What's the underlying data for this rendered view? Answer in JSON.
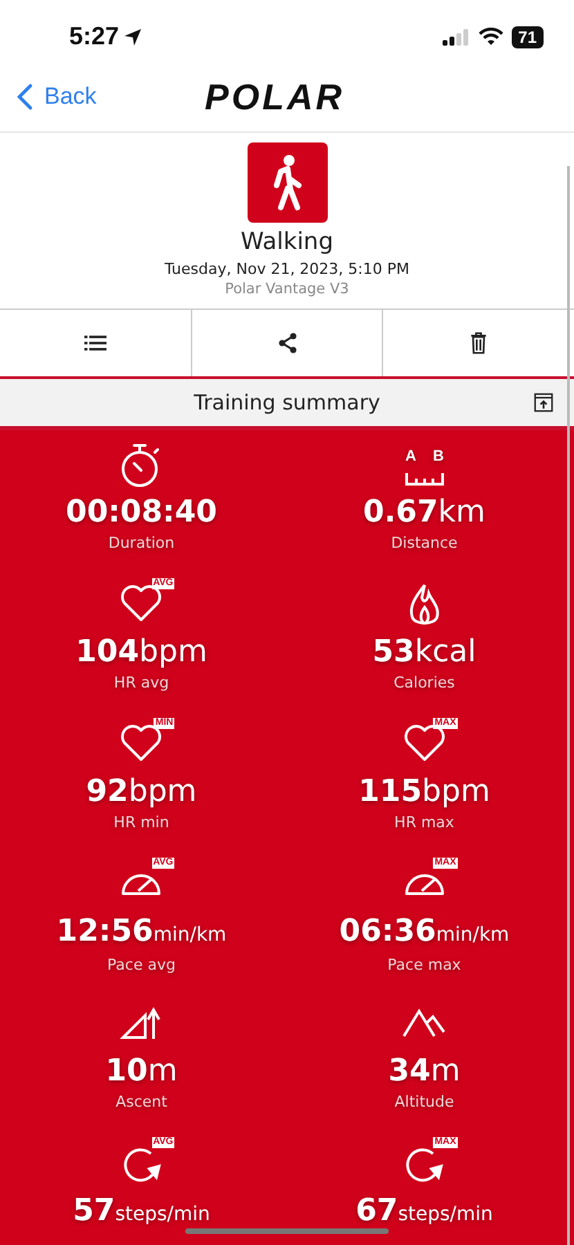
{
  "status_bar": {
    "time": "5:27",
    "battery": "71"
  },
  "nav": {
    "back": "Back",
    "logo": "POLAR"
  },
  "activity": {
    "title": "Walking",
    "date": "Tuesday, Nov 21, 2023, 5:10 PM",
    "device": "Polar Vantage V3"
  },
  "actions": [
    {
      "kind": "list"
    },
    {
      "kind": "share"
    },
    {
      "kind": "delete"
    }
  ],
  "section": {
    "title": "Training summary"
  },
  "ruler_marks": [
    "A",
    "B"
  ],
  "metrics": [
    {
      "kind": "stopwatch",
      "value": "00:08:40",
      "label": "Duration"
    },
    {
      "kind": "distance",
      "value": "0.67",
      "unit": "km",
      "label": "Distance"
    },
    {
      "kind": "heart",
      "badge": "AVG",
      "value": "104",
      "unit": "bpm",
      "label": "HR avg"
    },
    {
      "kind": "flame",
      "value": "53",
      "unit": "kcal",
      "label": "Calories"
    },
    {
      "kind": "heart",
      "badge": "MIN",
      "value": "92",
      "unit": "bpm",
      "label": "HR min"
    },
    {
      "kind": "heart",
      "badge": "MAX",
      "value": "115",
      "unit": "bpm",
      "label": "HR max"
    },
    {
      "kind": "gauge",
      "badge": "AVG",
      "value": "12:56",
      "unit": "min/km",
      "label": "Pace avg"
    },
    {
      "kind": "gauge",
      "badge": "MAX",
      "value": "06:36",
      "unit": "min/km",
      "label": "Pace max"
    },
    {
      "kind": "ascent",
      "value": "10",
      "unit": "m",
      "label": "Ascent"
    },
    {
      "kind": "mountain",
      "value": "34",
      "unit": "m",
      "label": "Altitude"
    },
    {
      "kind": "cadence",
      "badge": "AVG",
      "value": "57",
      "unit": "steps/min"
    },
    {
      "kind": "cadence",
      "badge": "MAX",
      "value": "67",
      "unit": "steps/min"
    }
  ]
}
